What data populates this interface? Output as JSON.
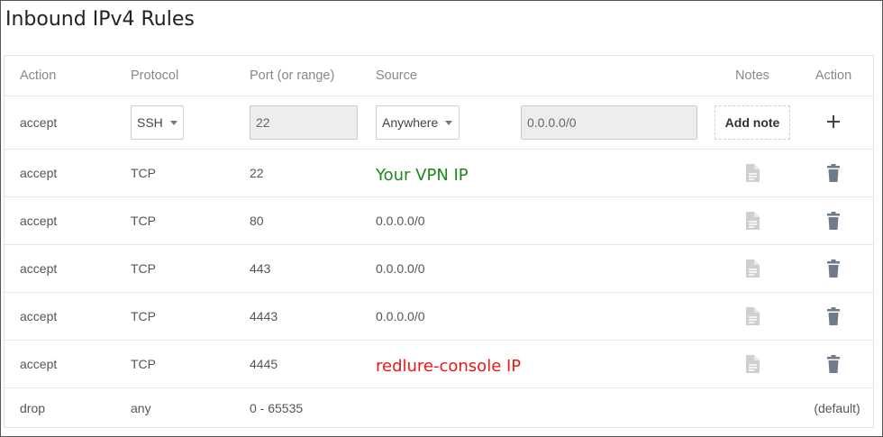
{
  "page": {
    "title": "Inbound IPv4 Rules"
  },
  "table": {
    "headers": {
      "action": "Action",
      "protocol": "Protocol",
      "port": "Port (or range)",
      "source": "Source",
      "notes": "Notes",
      "action2": "Action"
    },
    "new_rule": {
      "action": "accept",
      "protocol_selected": "SSH",
      "port_value": "22",
      "source_selected": "Anywhere",
      "source_value": "0.0.0.0/0",
      "add_note_label": "Add note",
      "add_icon": "plus-icon"
    },
    "rows": [
      {
        "action": "accept",
        "protocol": "TCP",
        "port": "22",
        "source": "Your VPN IP"
      },
      {
        "action": "accept",
        "protocol": "TCP",
        "port": "80",
        "source": "0.0.0.0/0"
      },
      {
        "action": "accept",
        "protocol": "TCP",
        "port": "443",
        "source": "0.0.0.0/0"
      },
      {
        "action": "accept",
        "protocol": "TCP",
        "port": "4443",
        "source": "0.0.0.0/0"
      },
      {
        "action": "accept",
        "protocol": "TCP",
        "port": "4445",
        "source": "redlure-console IP"
      }
    ],
    "default_row": {
      "action": "drop",
      "protocol": "any",
      "port": "0 - 65535",
      "label": "(default)"
    }
  },
  "icons": {
    "notes": "note-icon",
    "delete": "trash-icon"
  },
  "colors": {
    "annotation_green": "#1a8a1a",
    "annotation_red": "#e81818",
    "trash": "#6f7a8a",
    "note": "#cfcfcf"
  }
}
